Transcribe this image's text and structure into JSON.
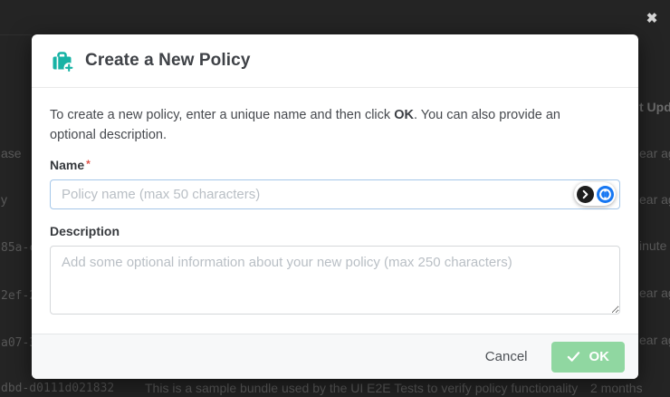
{
  "overlay": {
    "close_icon": "✖",
    "background_table": {
      "right_header_fragment": "t Upd",
      "left_fragments": [
        "ase",
        "y",
        "85a-c",
        "2ef-2",
        "a07-3"
      ],
      "right_fragments": [
        "ear ag",
        "ear ag",
        "inute",
        "ear ag",
        "ear ag"
      ],
      "bottom_row": {
        "id": "dbd-d0111d021832",
        "description": "This is a sample bundle used by the UI E2E Tests to verify policy functionality",
        "updated": "2 months"
      }
    }
  },
  "modal": {
    "title": "Create a New Policy",
    "intro": {
      "before_ok": "To create a new policy, enter a unique name and then click ",
      "ok_word": "OK",
      "after_ok": ". You can also provide an optional description."
    },
    "name_field": {
      "label": "Name",
      "required_mark": "*",
      "placeholder": "Policy name (max 50 characters)",
      "value": ""
    },
    "description_field": {
      "label": "Description",
      "placeholder": "Add some optional information about your new policy (max 250 characters)",
      "value": ""
    },
    "footer": {
      "cancel_label": "Cancel",
      "ok_label": "OK"
    },
    "colors": {
      "accent_teal": "#17b3a5",
      "ok_green": "#90d7a1",
      "required_red": "#e0544a",
      "focus_border": "#a5c7e9",
      "onepassword_blue": "#1777f2",
      "overlay_dark": "#242424"
    }
  }
}
